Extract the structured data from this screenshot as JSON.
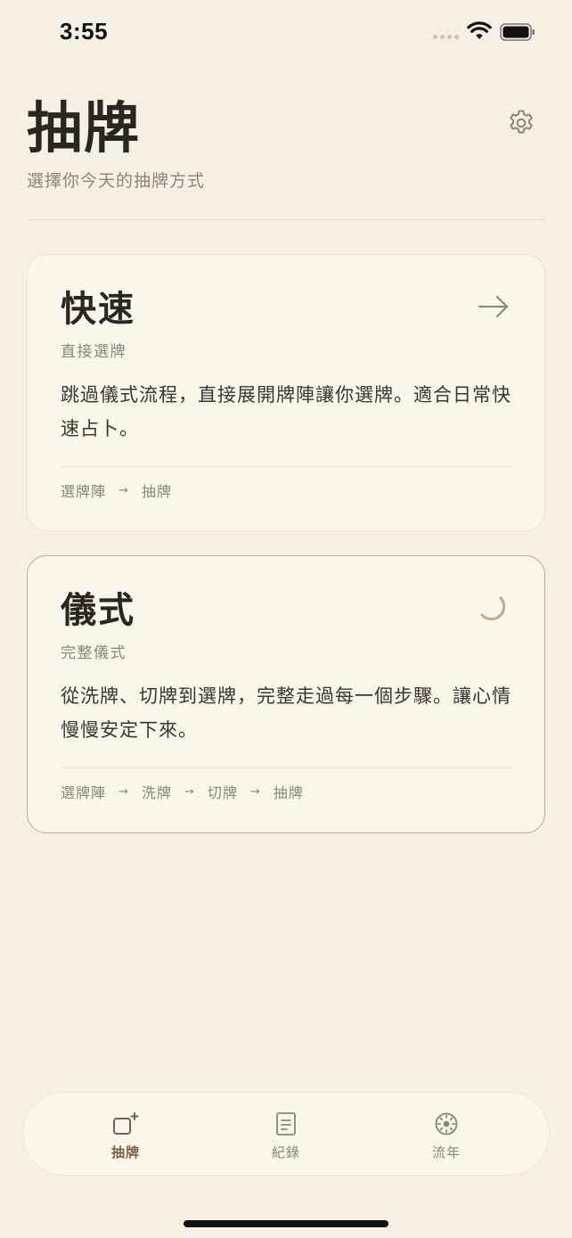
{
  "status_bar": {
    "time": "3:55"
  },
  "header": {
    "title": "抽牌",
    "subtitle": "選擇你今天的抽牌方式"
  },
  "cards": [
    {
      "title": "快速",
      "subtitle": "直接選牌",
      "description": "跳過儀式流程，直接展開牌陣讓你選牌。適合日常快速占卜。",
      "steps": [
        "選牌陣",
        "抽牌"
      ],
      "icon": "arrow-right-icon"
    },
    {
      "title": "儀式",
      "subtitle": "完整儀式",
      "description": "從洗牌、切牌到選牌，完整走過每一個步驟。讓心情慢慢安定下來。",
      "steps": [
        "選牌陣",
        "洗牌",
        "切牌",
        "抽牌"
      ],
      "icon": "loading-spinner-icon"
    }
  ],
  "tab_bar": {
    "tabs": [
      {
        "label": "抽牌",
        "icon": "add-card-icon",
        "active": true
      },
      {
        "label": "紀錄",
        "icon": "document-icon",
        "active": false
      },
      {
        "label": "流年",
        "icon": "compass-icon",
        "active": false
      }
    ]
  },
  "step_arrow": "→",
  "colors": {
    "background": "#f6efe3",
    "card": "#fbf6ea",
    "accent": "#c6a985",
    "text_primary": "#2b2720",
    "text_secondary": "#8c8478",
    "active_tab": "#7a6040"
  }
}
